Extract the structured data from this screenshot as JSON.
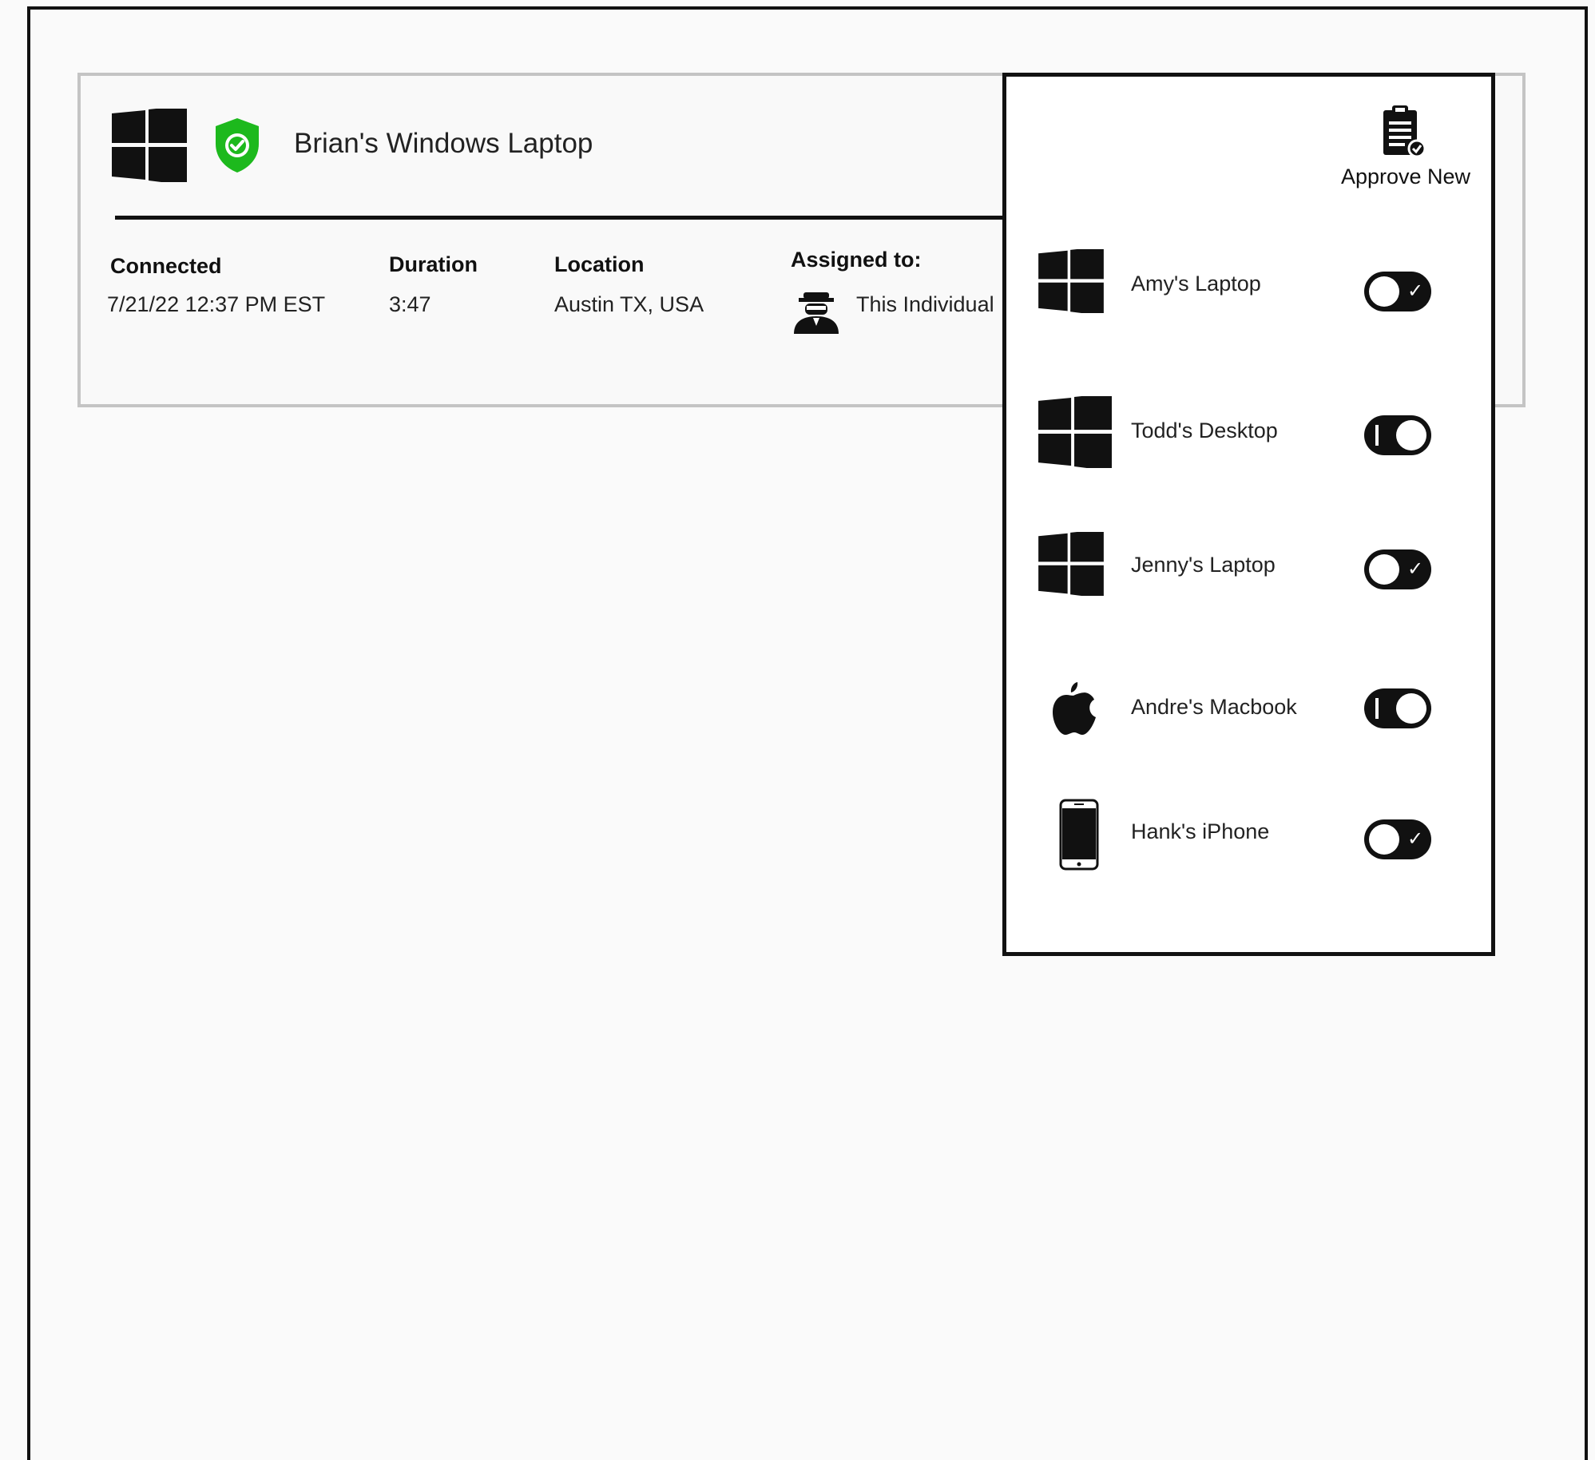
{
  "device": {
    "name": "Brian's Windows Laptop",
    "columns": {
      "connected_label": "Connected",
      "connected_value": "7/21/22  12:37 PM EST",
      "duration_label": "Duration",
      "duration_value": "3:47",
      "location_label": "Location",
      "location_value": "Austin TX, USA",
      "assigned_label": "Assigned to:",
      "assigned_value": "This Individual"
    },
    "status_color": "#1db91d"
  },
  "panel": {
    "approve_label": "Approve New",
    "devices": [
      {
        "name": "Amy's Laptop",
        "icon": "windows-icon",
        "enabled": false
      },
      {
        "name": "Todd's Desktop",
        "icon": "windows-icon",
        "enabled": true
      },
      {
        "name": "Jenny's Laptop",
        "icon": "windows-icon",
        "enabled": false
      },
      {
        "name": "Andre's Macbook",
        "icon": "apple-icon",
        "enabled": true
      },
      {
        "name": "Hank's iPhone",
        "icon": "phone-icon",
        "enabled": false
      }
    ]
  }
}
